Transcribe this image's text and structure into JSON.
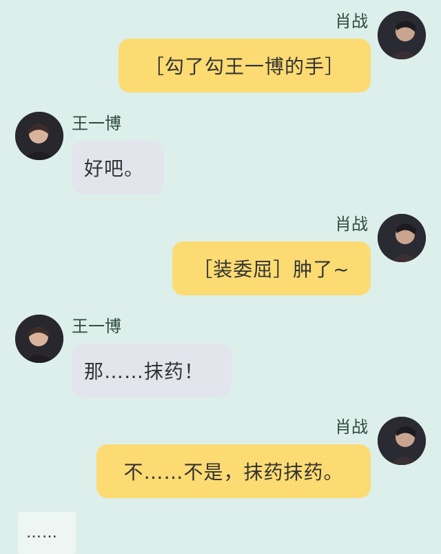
{
  "chat": {
    "messages": [
      {
        "sender": "肖战",
        "side": "right",
        "text": "［勾了勾王一博的手］"
      },
      {
        "sender": "王一博",
        "side": "left",
        "text": "好吧。"
      },
      {
        "sender": "肖战",
        "side": "right",
        "text": "［装委屈］肿了~"
      },
      {
        "sender": "王一博",
        "side": "left",
        "text": "那……抹药！"
      },
      {
        "sender": "肖战",
        "side": "right",
        "text": "不……不是，抹药抹药。"
      }
    ],
    "draft": "……"
  },
  "colors": {
    "background": "#dcefeb",
    "right_bubble": "#fcdb72",
    "left_bubble": "#e2e6ec",
    "name_text": "#2e4a3c"
  }
}
